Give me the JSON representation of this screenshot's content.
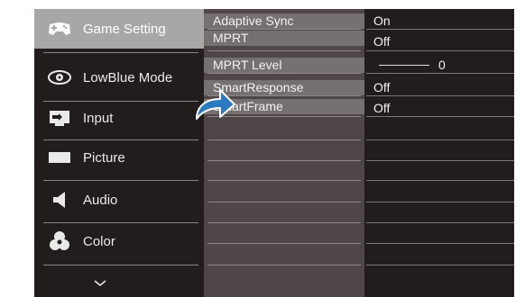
{
  "menu": {
    "items": [
      {
        "label": "Game Setting",
        "icon": "gamepad-icon",
        "active": true
      },
      {
        "label": "LowBlue Mode",
        "icon": "eye-icon"
      },
      {
        "label": "Input",
        "icon": "input-icon"
      },
      {
        "label": "Picture",
        "icon": "picture-icon"
      },
      {
        "label": "Audio",
        "icon": "speaker-icon"
      },
      {
        "label": "Color",
        "icon": "color-icon"
      }
    ],
    "more_icon": "chevron-down-icon"
  },
  "submenu": {
    "items": [
      {
        "label": "Adaptive Sync",
        "value": "On"
      },
      {
        "label": "MPRT",
        "value": "Off"
      },
      {
        "label": "MPRT Level",
        "value": "0",
        "slider": true
      },
      {
        "label": "SmartResponse",
        "value": "Off"
      },
      {
        "label": "SmartFrame",
        "value": "Off"
      }
    ]
  },
  "colors": {
    "background": "#231c1c",
    "active_menu": "#a7a7a7",
    "middle_panel": "#4f4747",
    "arrow": "#2a7ac0"
  }
}
